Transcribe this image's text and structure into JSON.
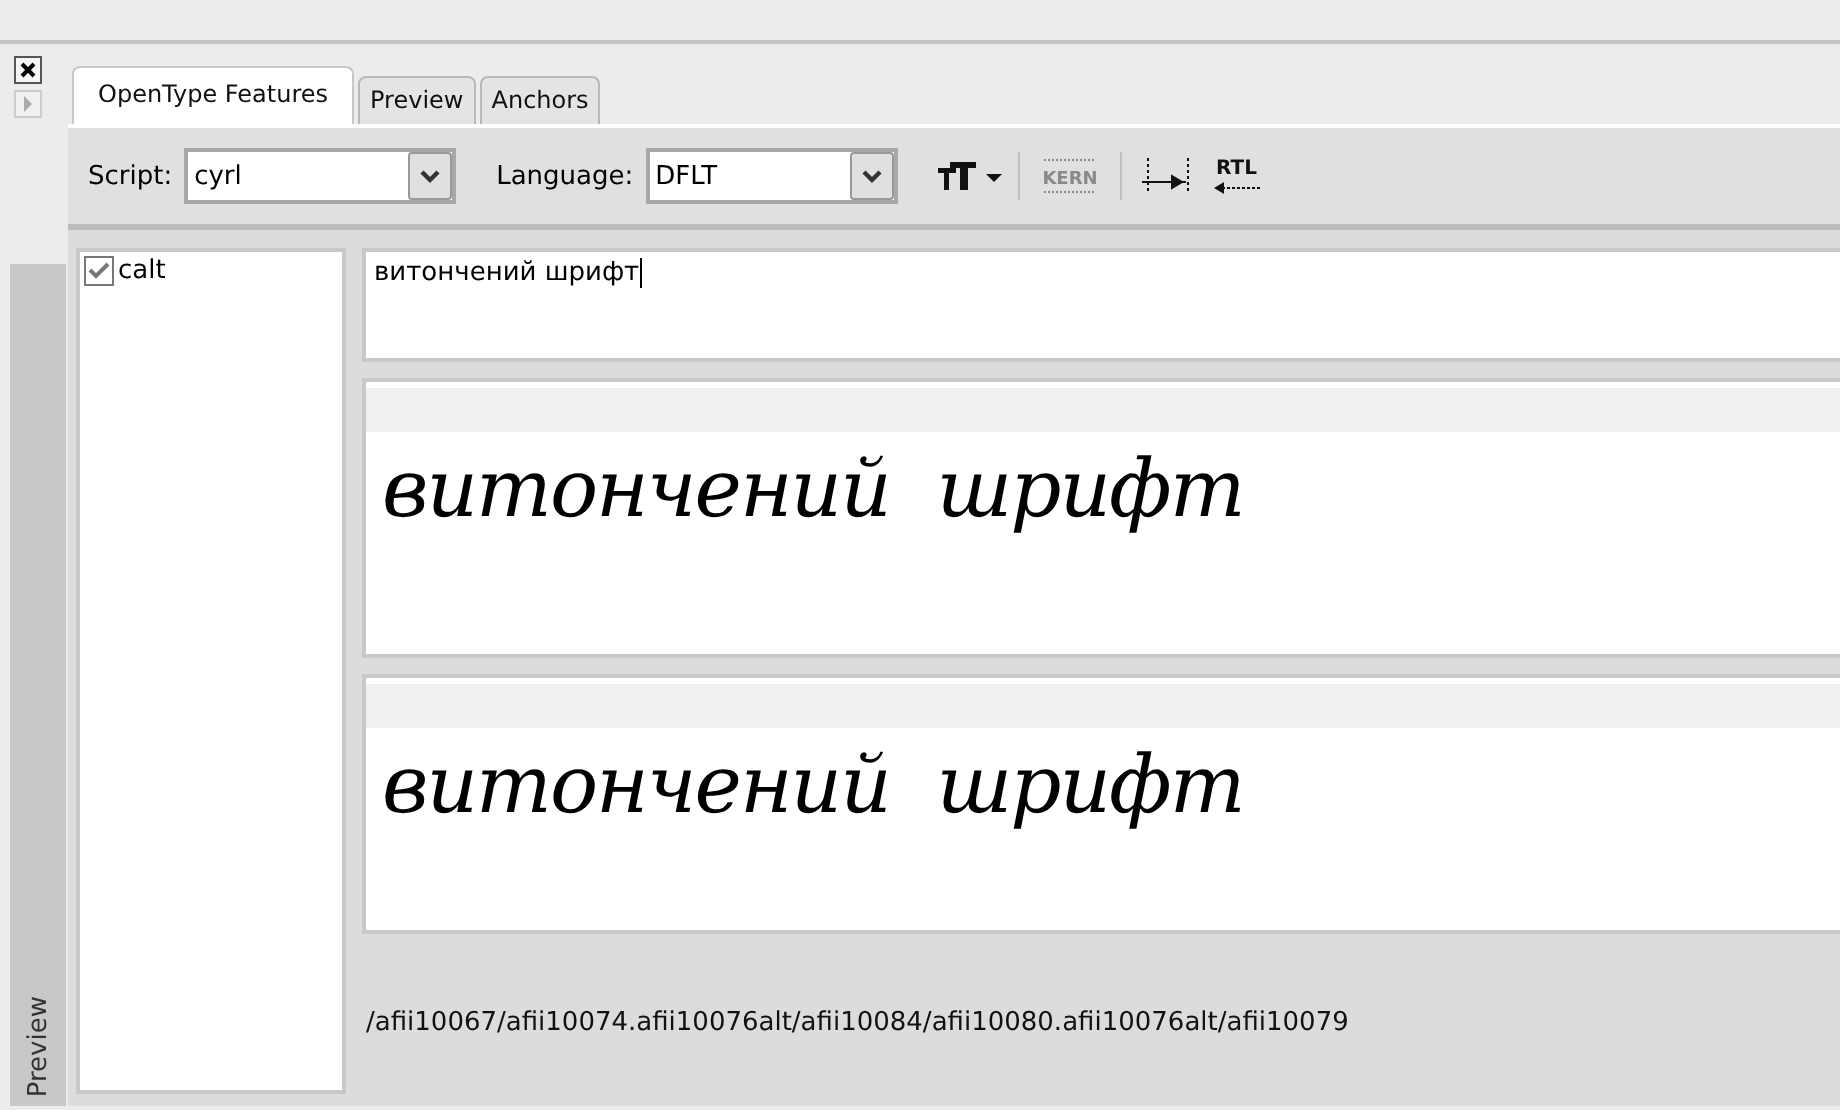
{
  "side_panel": {
    "tab": {
      "label": "Preview"
    }
  },
  "tabs": [
    {
      "label": "OpenType Features",
      "selected": true
    },
    {
      "label": "Preview",
      "selected": false
    },
    {
      "label": "Anchors",
      "selected": false
    }
  ],
  "toolbar": {
    "script": {
      "label": "Script:",
      "value": "cyrl"
    },
    "language": {
      "label": "Language:",
      "value": "DFLT"
    },
    "buttons": [
      {
        "kind": "font-size",
        "disabled": false
      },
      {
        "kind": "kern",
        "label": "KERN",
        "disabled": true
      },
      {
        "kind": "spacing",
        "disabled": false
      },
      {
        "kind": "rtl",
        "label": "RTL",
        "disabled": false
      }
    ]
  },
  "features": [
    {
      "tag": "calt",
      "checked": true
    }
  ],
  "input": {
    "value": "витончений шрифт"
  },
  "previews": [
    {
      "text": "витончений  шрифт"
    },
    {
      "text": "витончений  шрифт"
    }
  ],
  "glyph_names": "/afii10067/afii10074.afii10076alt/afii10084/afii10080.afii10076alt/afii10079"
}
